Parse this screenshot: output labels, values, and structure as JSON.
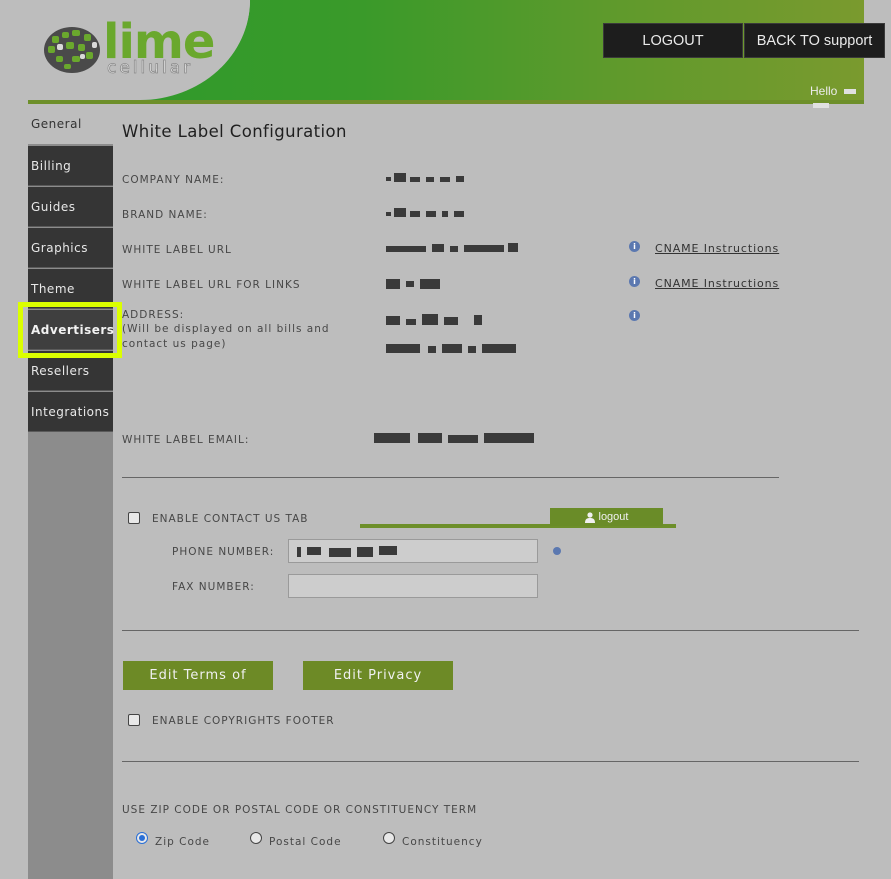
{
  "header": {
    "logo_main": "lime",
    "logo_sub": "cellular",
    "logout_label": "LOGOUT",
    "back_label": "BACK TO support",
    "hello_label": "Hello"
  },
  "sidebar": {
    "tabs": [
      "General",
      "Billing",
      "Guides",
      "Graphics",
      "Theme",
      "Advertisers",
      "Resellers",
      "Integrations"
    ],
    "active": "Advertisers"
  },
  "main": {
    "title": "White Label Configuration",
    "company_name_label": "COMPANY NAME:",
    "brand_name_label": "BRAND NAME:",
    "white_label_url_label": "WHITE LABEL URL",
    "white_label_url_links_label": "WHITE LABEL URL FOR LINKS",
    "address_label": "ADDRESS:",
    "address_note_1": "(Will be displayed on all bills and",
    "address_note_2": "contact us page)",
    "cname_link_1": "CNAME Instructions",
    "cname_link_2": "CNAME Instructions",
    "white_label_email_label": "WHITE LABEL EMAIL:",
    "enable_contact_label": "ENABLE CONTACT US TAB",
    "preview_logout_label": "logout",
    "phone_label": "PHONE NUMBER:",
    "fax_label": "FAX NUMBER:",
    "edit_terms_label": "Edit Terms of",
    "edit_privacy_label": "Edit Privacy",
    "enable_copyrights_label": "ENABLE COPYRIGHTS FOOTER",
    "zip_heading": "USE ZIP CODE OR POSTAL CODE OR CONSTITUENCY TERM",
    "radio_zip": "Zip Code",
    "radio_postal": "Postal Code",
    "radio_constituency": "Constituency",
    "radio_selected": "Zip Code"
  },
  "colors": {
    "header_green": "#3a9a2a",
    "button_green": "#6d8a26",
    "highlight": "#dbff00",
    "info_icon": "#5b78b0"
  }
}
